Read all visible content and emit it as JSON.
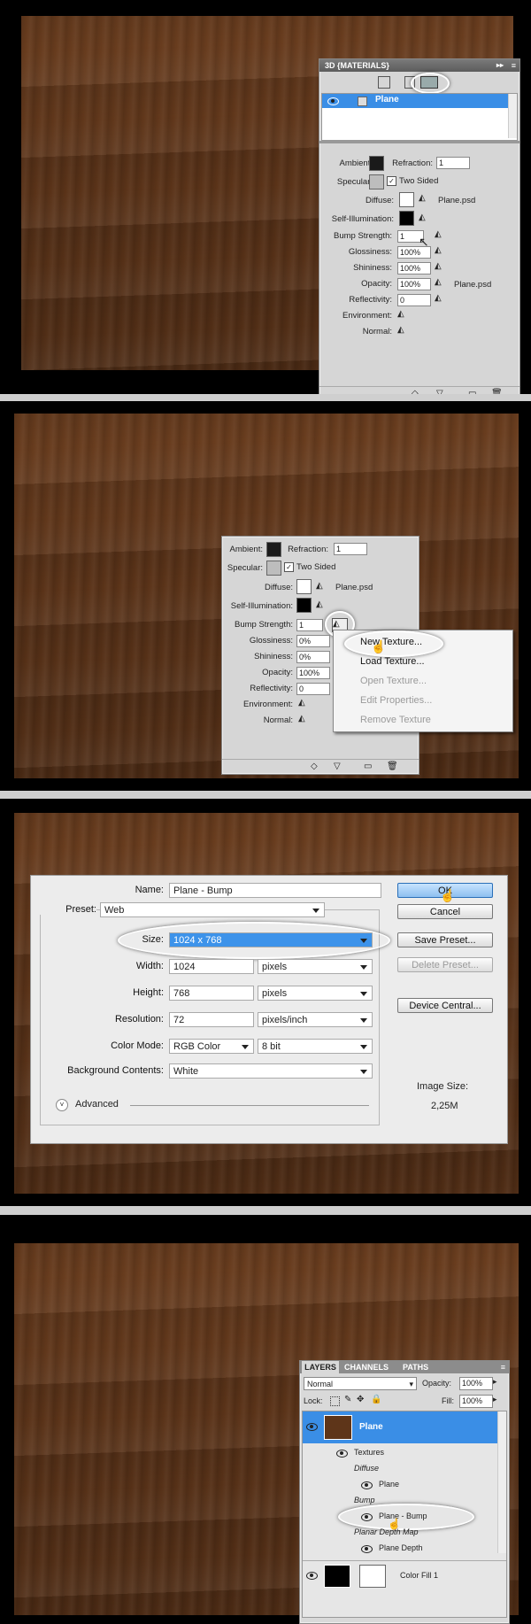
{
  "panel1": {
    "title": "3D {MATERIALS}",
    "layer_name": "Plane",
    "labels": {
      "ambient": "Ambient:",
      "refraction": "Refraction:",
      "specular": "Specular:",
      "two_sided": "Two Sided",
      "diffuse": "Diffuse:",
      "self_illumination": "Self-Illumination:",
      "bump_strength": "Bump Strength:",
      "glossiness": "Glossiness:",
      "shininess": "Shininess:",
      "opacity": "Opacity:",
      "reflectivity": "Reflectivity:",
      "environment": "Environment:",
      "normal": "Normal:"
    },
    "values": {
      "refraction": "1",
      "bump_strength": "1",
      "glossiness": "100%",
      "shininess": "100%",
      "opacity": "100%",
      "reflectivity": "0",
      "diffuse_file": "Plane.psd",
      "opacity_file": "Plane.psd"
    },
    "colors": {
      "ambient": "#1a1a1a",
      "specular": "#bdbdbd",
      "diffuse": "#ffffff",
      "self_illumination": "#000000"
    }
  },
  "panel2": {
    "labels": {
      "ambient": "Ambient:",
      "refraction": "Refraction:",
      "specular": "Specular:",
      "two_sided": "Two Sided",
      "diffuse": "Diffuse:",
      "self_illumination": "Self-Illumination:",
      "bump_strength": "Bump Strength:",
      "glossiness": "Glossiness:",
      "shininess": "Shininess:",
      "opacity": "Opacity:",
      "reflectivity": "Reflectivity:",
      "environment": "Environment:",
      "normal": "Normal:"
    },
    "values": {
      "refraction": "1",
      "bump_strength": "1",
      "glossiness": "0%",
      "shininess": "0%",
      "opacity": "100%",
      "reflectivity": "0",
      "diffuse_file": "Plane.psd"
    },
    "menu": [
      "New Texture...",
      "Load Texture...",
      "Open Texture...",
      "Edit Properties...",
      "Remove Texture"
    ]
  },
  "dialog": {
    "name_label": "Name:",
    "name_value": "Plane - Bump",
    "preset_label": "Preset:",
    "preset_value": "Web",
    "size_label": "Size:",
    "size_value": "1024 x 768",
    "width_label": "Width:",
    "width_value": "1024",
    "width_unit": "pixels",
    "height_label": "Height:",
    "height_value": "768",
    "height_unit": "pixels",
    "resolution_label": "Resolution:",
    "resolution_value": "72",
    "resolution_unit": "pixels/inch",
    "color_mode_label": "Color Mode:",
    "color_mode_value": "RGB Color",
    "bit_depth": "8 bit",
    "bg_label": "Background Contents:",
    "bg_value": "White",
    "advanced": "Advanced",
    "ok": "OK",
    "cancel": "Cancel",
    "save_preset": "Save Preset...",
    "delete_preset": "Delete Preset...",
    "device_central": "Device Central...",
    "image_size_label": "Image Size:",
    "image_size_value": "2,25M"
  },
  "layers": {
    "tabs": [
      "LAYERS",
      "CHANNELS",
      "PATHS"
    ],
    "blend_mode": "Normal",
    "opacity_label": "Opacity:",
    "opacity_value": "100%",
    "lock_label": "Lock:",
    "fill_label": "Fill:",
    "fill_value": "100%",
    "layer_plane": "Plane",
    "textures": "Textures",
    "diffuse": "Diffuse",
    "plane": "Plane",
    "bump": "Bump",
    "plane_bump": "Plane - Bump",
    "planar_depth_map": "Planar Depth Map",
    "plane_depth": "Plane Depth",
    "color_fill": "Color Fill 1"
  }
}
